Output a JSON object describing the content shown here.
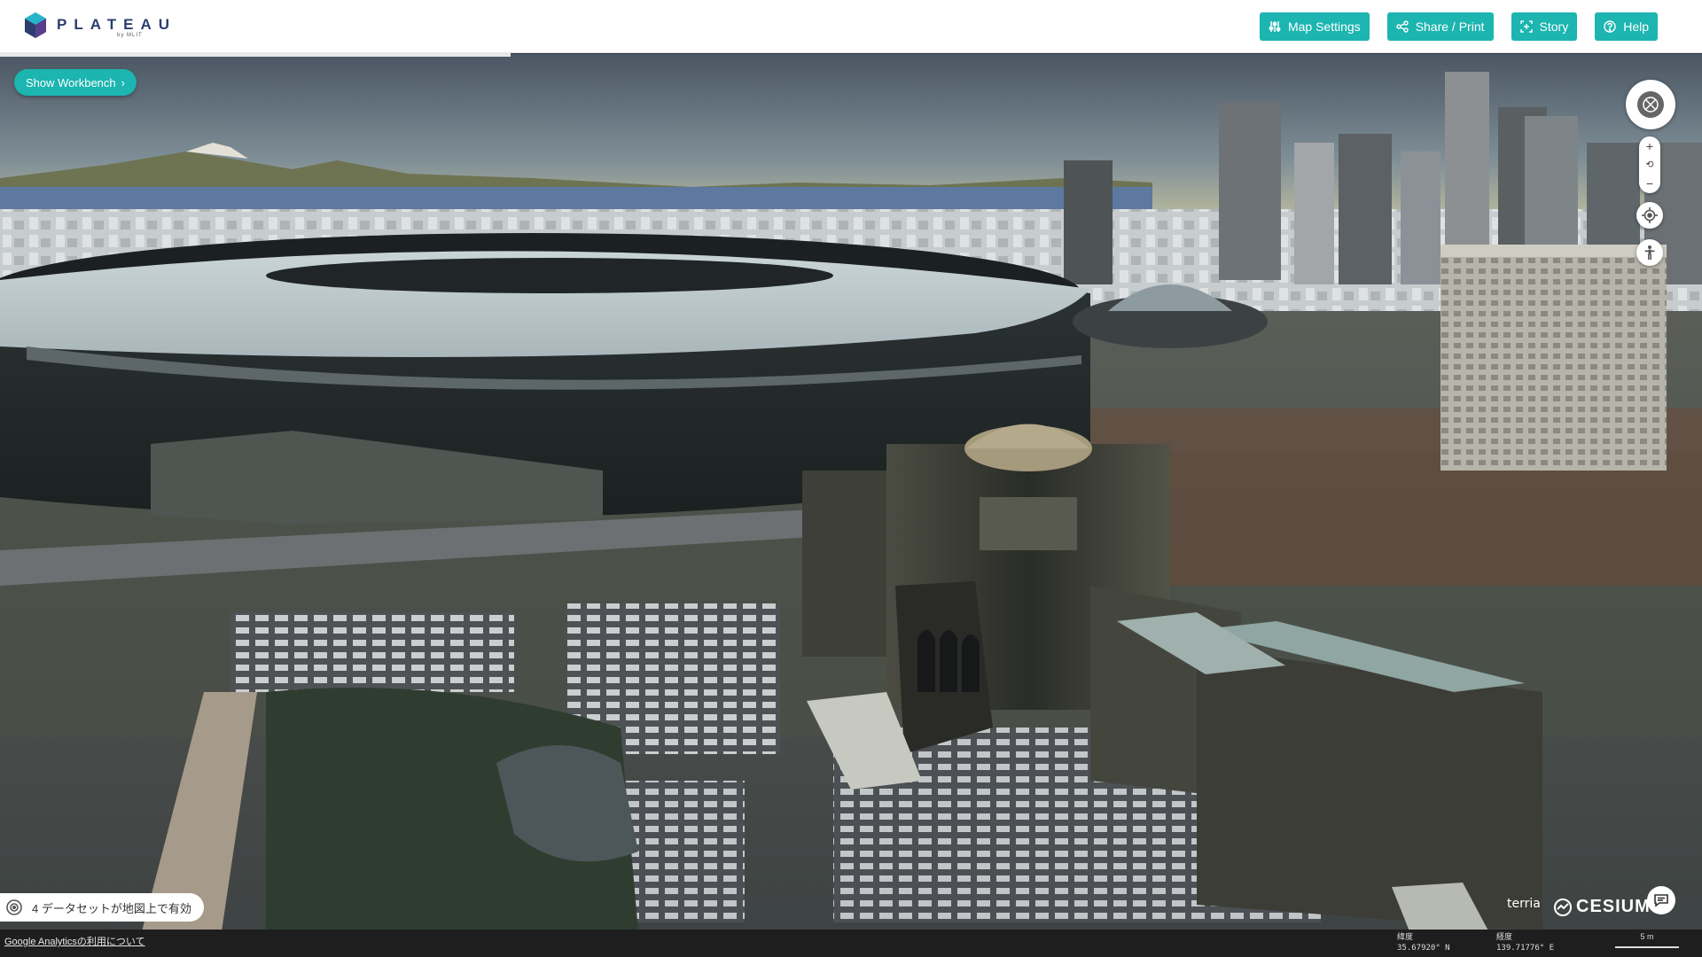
{
  "header": {
    "logo_text": "PLATEAU",
    "logo_sub": "by MLIT",
    "nav": [
      {
        "label": "Map Settings",
        "icon": "sliders-icon"
      },
      {
        "label": "Share / Print",
        "icon": "share-icon"
      },
      {
        "label": "Story",
        "icon": "story-icon"
      },
      {
        "label": "Help",
        "icon": "help-icon"
      }
    ]
  },
  "workbench": {
    "label": "Show Workbench"
  },
  "controls": {
    "zoom_in": "+",
    "zoom_reset": "⟲",
    "zoom_out": "−"
  },
  "status": {
    "datasets": "4 データセットが地図上で有効"
  },
  "footer": {
    "ga_link": "Google Analyticsの利用について",
    "lat_label": "緯度",
    "lat_value": "35.67920° N",
    "lon_label": "経度",
    "lon_value": "139.71776° E",
    "scale": "5 m"
  },
  "attribution": {
    "terria": "terria",
    "cesium": "CESIUM"
  },
  "colors": {
    "accent": "#1cb5b0",
    "header_bg": "#ffffff",
    "footer_bg": "#1e1e1e"
  }
}
